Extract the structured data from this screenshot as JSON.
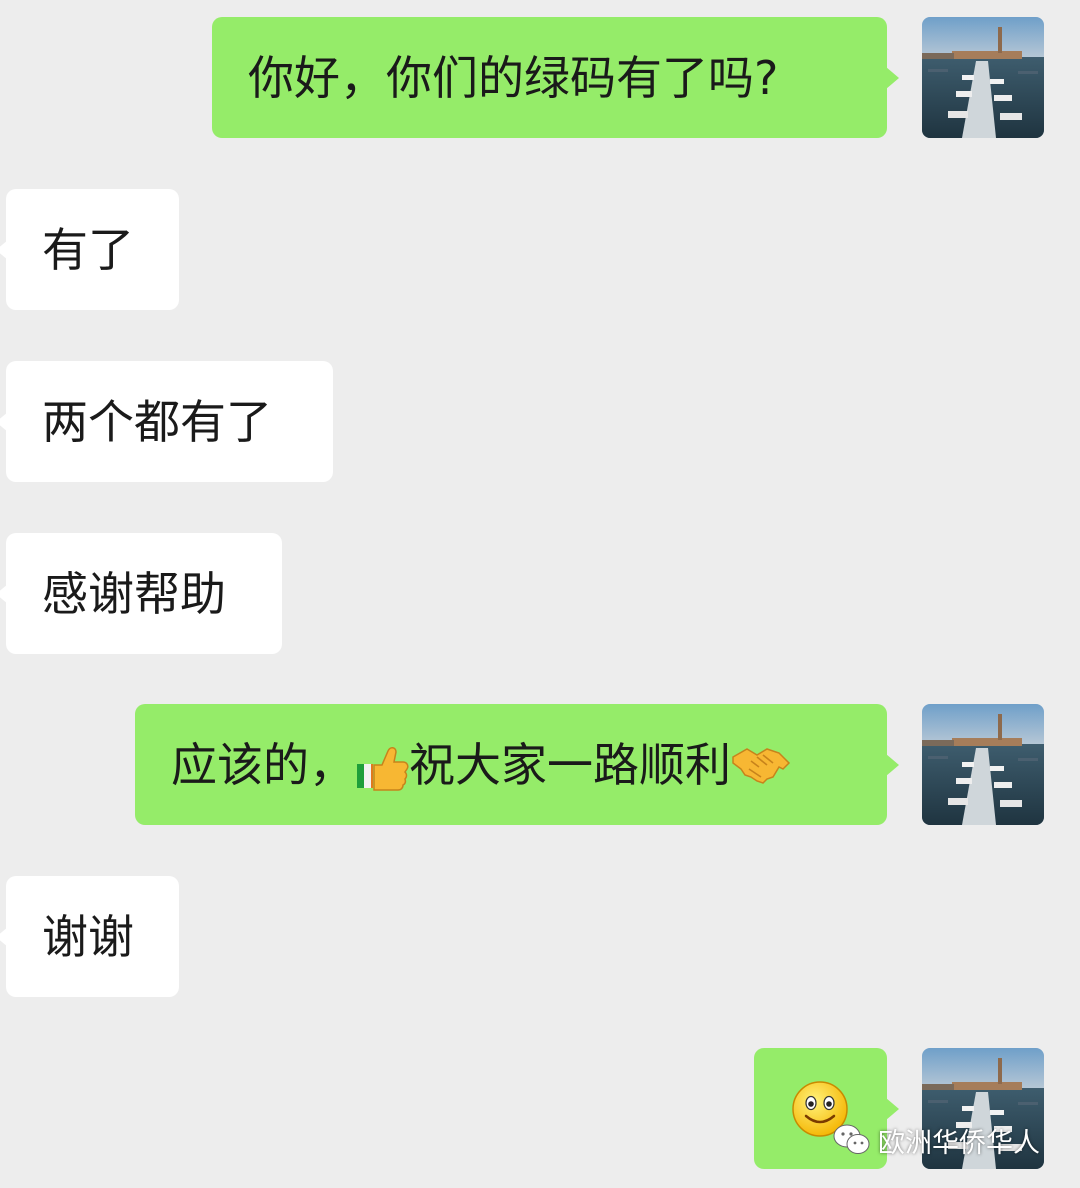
{
  "messages": [
    {
      "id": "m1",
      "side": "outgoing",
      "text": "你好，你们的绿码有了吗?"
    },
    {
      "id": "m2",
      "side": "incoming",
      "text": "有了"
    },
    {
      "id": "m3",
      "side": "incoming",
      "text": "两个都有了"
    },
    {
      "id": "m4",
      "side": "incoming",
      "text": "感谢帮助"
    },
    {
      "id": "m5",
      "side": "outgoing",
      "parts": [
        "应该的，",
        "祝大家一路顺利"
      ],
      "emojis": [
        "thumbs-up-icon",
        "handshake-icon"
      ]
    },
    {
      "id": "m6",
      "side": "incoming",
      "text": "谢谢"
    },
    {
      "id": "m7",
      "side": "outgoing",
      "emojis": [
        "smile-emoji-icon"
      ]
    }
  ],
  "avatar": {
    "icon": "harbor-photo-avatar"
  },
  "watermark": {
    "icon": "wechat-icon",
    "text": "欧洲华侨华人"
  },
  "colors": {
    "background": "#ededed",
    "outgoing_bubble": "#95ec69",
    "incoming_bubble": "#ffffff",
    "text": "#1a1a1a"
  }
}
